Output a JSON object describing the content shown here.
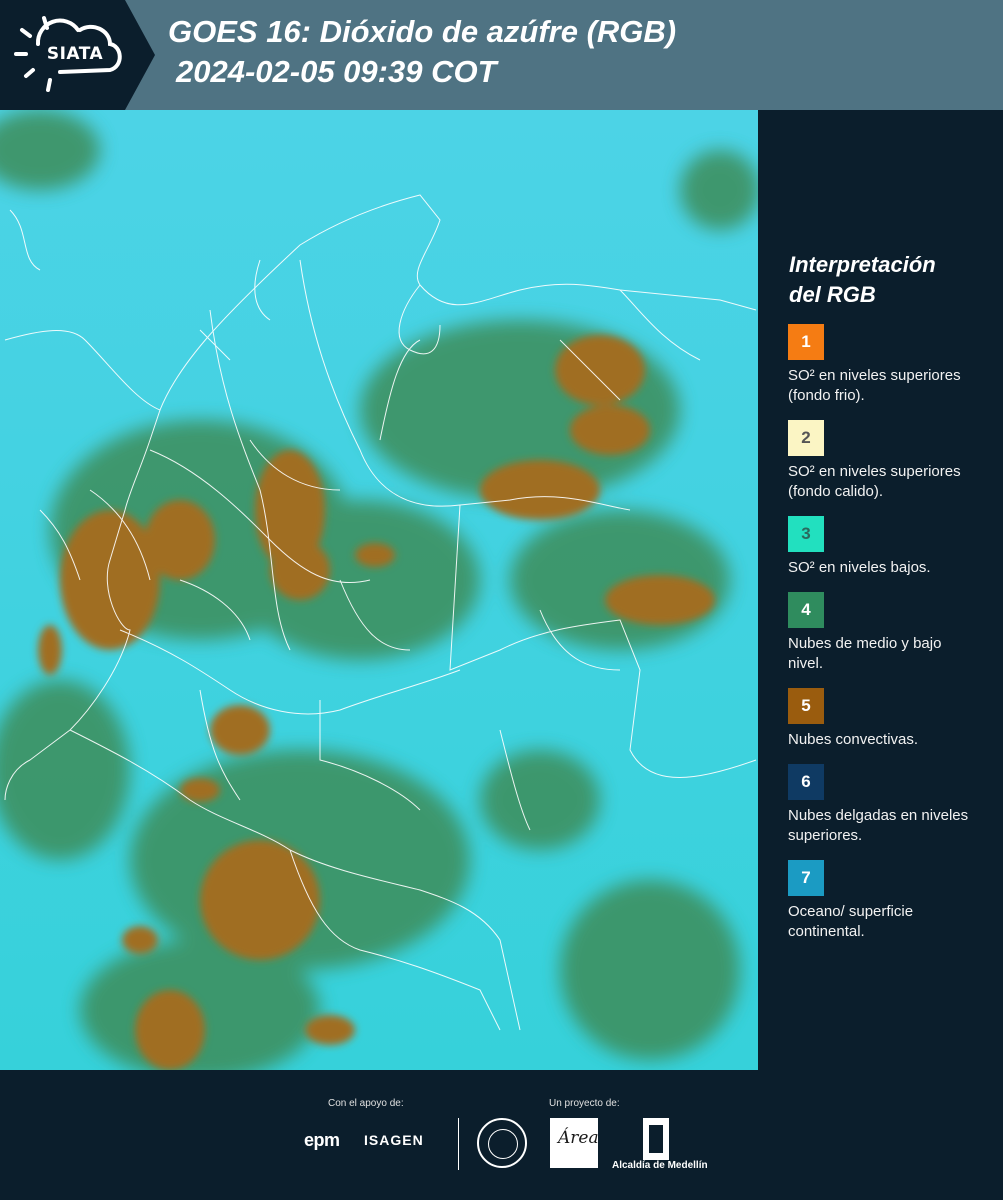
{
  "header": {
    "logo_text": "SIATA",
    "title_line1": "GOES 16: Dióxido de azúfre (RGB)",
    "title_line2": "2024-02-05 09:39 COT"
  },
  "legend": {
    "title_line1": "Interpretación",
    "title_line2": "del RGB",
    "items": [
      {
        "number": "1",
        "label": "SO² en niveles superiores (fondo frio).",
        "color": "#f57c13",
        "number_color": "#ffffff"
      },
      {
        "number": "2",
        "label": "SO² en niveles superiores (fondo calido).",
        "color": "#fbf5c4",
        "number_color": "#555555"
      },
      {
        "number": "3",
        "label": "SO² en niveles bajos.",
        "color": "#22e0bf",
        "number_color": "#2a6a5e"
      },
      {
        "number": "4",
        "label": "Nubes de medio y bajo nivel.",
        "color": "#2f8c5e",
        "number_color": "#ffffff"
      },
      {
        "number": "5",
        "label": "Nubes convectivas.",
        "color": "#9a5c0e",
        "number_color": "#ffffff"
      },
      {
        "number": "6",
        "label": "Nubes delgadas en niveles superiores.",
        "color": "#0f3a63",
        "number_color": "#ffffff"
      },
      {
        "number": "7",
        "label": "Oceano/ superficie continental.",
        "color": "#1b9bc3",
        "number_color": "#ffffff"
      }
    ]
  },
  "footer": {
    "support_caption": "Con el apoyo de:",
    "project_caption": "Un proyecto de:",
    "sponsor_1": "epm",
    "sponsor_2": "ISAGEN",
    "area_logo_text": "Área",
    "alcaldia_text": "Alcaldía de Medellín"
  },
  "colors": {
    "header_bg": "#4f7383",
    "page_bg": "#0b1e2c",
    "map_cyan": "#39d2de",
    "map_green": "#3a8a5a",
    "map_brown": "#9c6a22"
  }
}
